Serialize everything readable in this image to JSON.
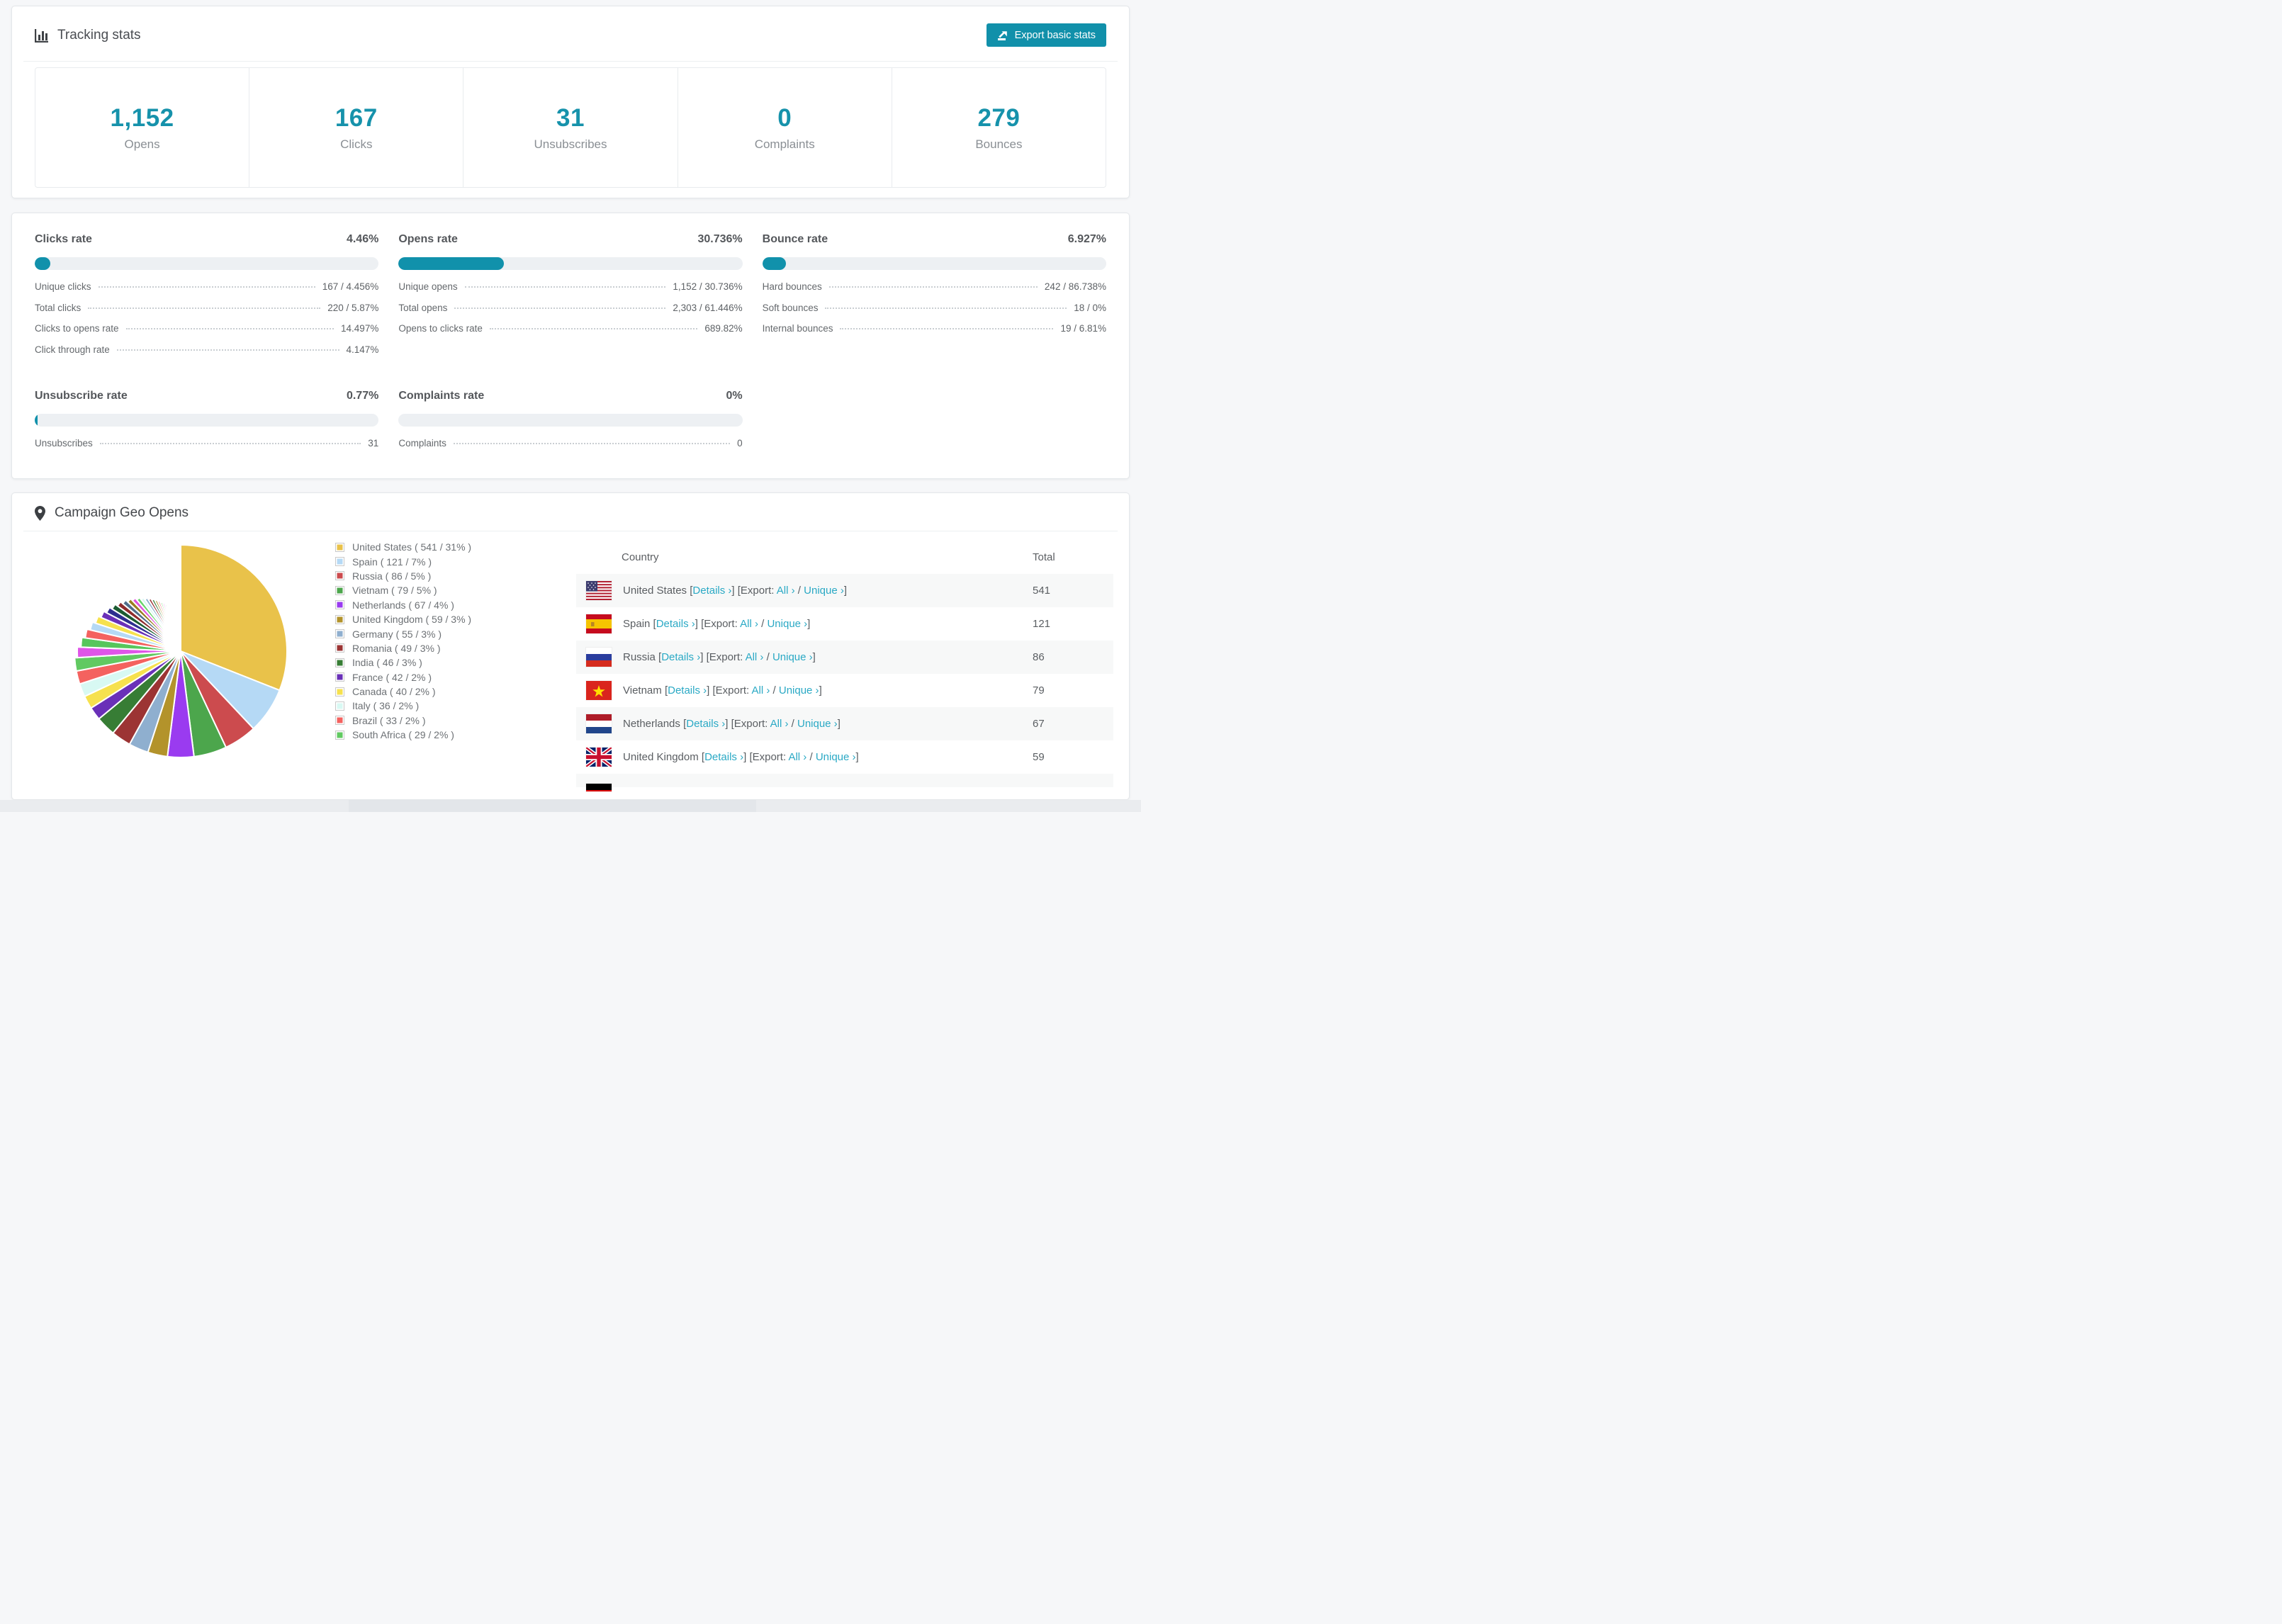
{
  "accent": {
    "teal": "#1692ab",
    "link": "#2aa9c5",
    "bar_fill": "#1191ab",
    "bar_track": "#edf0f3"
  },
  "tracking": {
    "title": "Tracking stats",
    "export_label": "Export basic stats",
    "stats": [
      {
        "value": "1,152",
        "label": "Opens"
      },
      {
        "value": "167",
        "label": "Clicks"
      },
      {
        "value": "31",
        "label": "Unsubscribes"
      },
      {
        "value": "0",
        "label": "Complaints"
      },
      {
        "value": "279",
        "label": "Bounces"
      }
    ]
  },
  "rates": [
    {
      "title": "Clicks rate",
      "value": "4.46%",
      "fill": 4.46,
      "rows": [
        {
          "label": "Unique clicks",
          "value": "167 / 4.456%"
        },
        {
          "label": "Total clicks",
          "value": "220 / 5.87%"
        },
        {
          "label": "Clicks to opens rate",
          "value": "14.497%"
        },
        {
          "label": "Click through rate",
          "value": "4.147%"
        }
      ]
    },
    {
      "title": "Opens rate",
      "value": "30.736%",
      "fill": 30.736,
      "rows": [
        {
          "label": "Unique opens",
          "value": "1,152 / 30.736%"
        },
        {
          "label": "Total opens",
          "value": "2,303 / 61.446%"
        },
        {
          "label": "Opens to clicks rate",
          "value": "689.82%"
        }
      ]
    },
    {
      "title": "Bounce rate",
      "value": "6.927%",
      "fill": 6.927,
      "rows": [
        {
          "label": "Hard bounces",
          "value": "242 / 86.738%"
        },
        {
          "label": "Soft bounces",
          "value": "18 / 0%"
        },
        {
          "label": "Internal bounces",
          "value": "19 / 6.81%"
        }
      ]
    },
    {
      "title": "Unsubscribe rate",
      "value": "0.77%",
      "fill": 0.77,
      "rows": [
        {
          "label": "Unsubscribes",
          "value": "31"
        }
      ]
    },
    {
      "title": "Complaints rate",
      "value": "0%",
      "fill": 0,
      "rows": [
        {
          "label": "Complaints",
          "value": "0"
        }
      ]
    }
  ],
  "geo": {
    "title": "Campaign Geo Opens",
    "table": {
      "columns": [
        "Country",
        "Total"
      ],
      "link_labels": {
        "details": "Details ›",
        "export_prefix": "Export:",
        "all": "All ›",
        "unique": "Unique ›"
      },
      "rows": [
        {
          "country": "United States",
          "flag": "us",
          "total": "541"
        },
        {
          "country": "Spain",
          "flag": "es",
          "total": "121"
        },
        {
          "country": "Russia",
          "flag": "ru",
          "total": "86"
        },
        {
          "country": "Vietnam",
          "flag": "vn",
          "total": "79"
        },
        {
          "country": "Netherlands",
          "flag": "nl",
          "total": "67"
        },
        {
          "country": "United Kingdom",
          "flag": "gb",
          "total": "59"
        }
      ],
      "partial_row": {
        "country": "Germany",
        "flag": "de"
      }
    }
  },
  "chart_data": {
    "type": "pie",
    "title": "Campaign Geo Opens",
    "legend_position": "right",
    "start_angle_deg": -90,
    "direction": "clockwise",
    "series": [
      {
        "name": "United States",
        "value": 541,
        "pct": 31,
        "color": "#e9c24a"
      },
      {
        "name": "Spain",
        "value": 121,
        "pct": 7,
        "color": "#b5d9f5"
      },
      {
        "name": "Russia",
        "value": 86,
        "pct": 5,
        "color": "#cc4b4e"
      },
      {
        "name": "Vietnam",
        "value": 79,
        "pct": 5,
        "color": "#4ca64c"
      },
      {
        "name": "Netherlands",
        "value": 67,
        "pct": 4,
        "color": "#9a3bf0"
      },
      {
        "name": "United Kingdom",
        "value": 59,
        "pct": 3,
        "color": "#b3932b"
      },
      {
        "name": "Germany",
        "value": 55,
        "pct": 3,
        "color": "#8fafcf"
      },
      {
        "name": "Romania",
        "value": 49,
        "pct": 3,
        "color": "#9c3434"
      },
      {
        "name": "India",
        "value": 46,
        "pct": 3,
        "color": "#377d35"
      },
      {
        "name": "France",
        "value": 42,
        "pct": 2,
        "color": "#6a30b8"
      },
      {
        "name": "Canada",
        "value": 40,
        "pct": 2,
        "color": "#f6e14e"
      },
      {
        "name": "Italy",
        "value": 36,
        "pct": 2,
        "color": "#d8f9f3"
      },
      {
        "name": "Brazil",
        "value": 33,
        "pct": 2,
        "color": "#f4625f"
      },
      {
        "name": "South Africa",
        "value": 29,
        "pct": 2,
        "color": "#61c961"
      }
    ],
    "other_slices": {
      "count": 36,
      "total_pct": 26,
      "start_pct": 1.5,
      "decay": 0.945,
      "palette": [
        "#df55e8",
        "#57c65c",
        "#f4625f",
        "#b5d9f5",
        "#f6e14e",
        "#6a30b8",
        "#2e2e8f",
        "#1c5c32",
        "#8f2c2c",
        "#4f6d8a",
        "#9a7d1f",
        "#e052e0",
        "#66d46a",
        "#d8f9f3",
        "#8fafcf",
        "#9c3434",
        "#377d35",
        "#b3932b",
        "#f07f7f",
        "#7ee07e"
      ]
    }
  }
}
